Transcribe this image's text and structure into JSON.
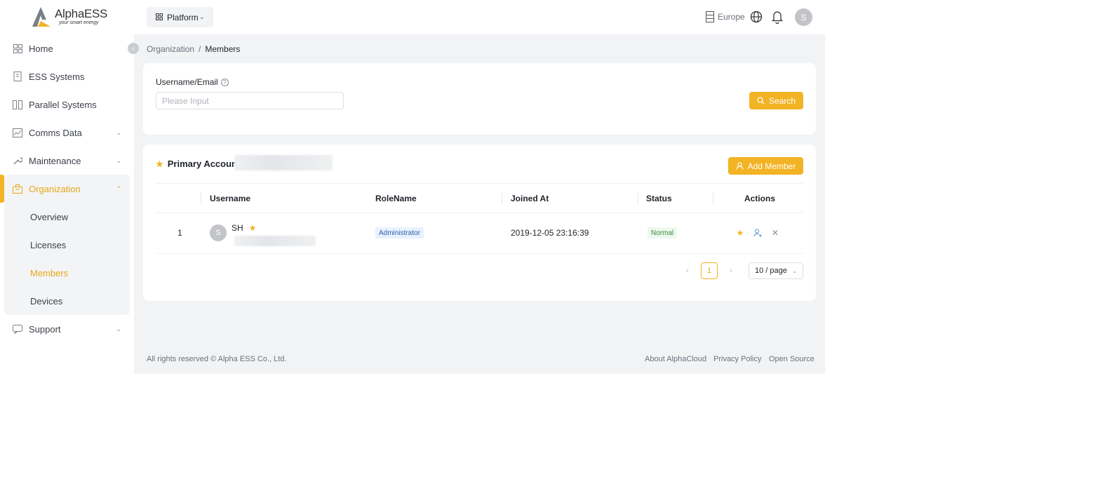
{
  "brand": {
    "name": "AlphaESS",
    "tagline": "your smart energy"
  },
  "sidebar": {
    "items": [
      {
        "label": "Home",
        "icon": "home-icon"
      },
      {
        "label": "ESS Systems",
        "icon": "ess-icon"
      },
      {
        "label": "Parallel Systems",
        "icon": "parallel-icon"
      },
      {
        "label": "Comms Data",
        "icon": "chart-icon"
      },
      {
        "label": "Maintenance",
        "icon": "wrench-icon"
      },
      {
        "label": "Organization",
        "icon": "building-icon"
      },
      {
        "label": "Support",
        "icon": "chat-icon"
      }
    ],
    "org_sub": [
      {
        "label": "Overview"
      },
      {
        "label": "Licenses"
      },
      {
        "label": "Members"
      },
      {
        "label": "Devices"
      }
    ],
    "accent": "#f2b324"
  },
  "topbar": {
    "platform_label": "Platform",
    "region": "Europe",
    "avatar_initial": "S"
  },
  "breadcrumb": {
    "parent": "Organization",
    "separator": "/",
    "current": "Members"
  },
  "search": {
    "label": "Username/Email",
    "placeholder": "Please Input",
    "button": "Search"
  },
  "members": {
    "primary_label": "Primary Account",
    "add_button": "Add Member",
    "columns": [
      "Username",
      "RoleName",
      "Joined At",
      "Status",
      "Actions"
    ],
    "rows": [
      {
        "index": "1",
        "avatar": "S",
        "username": "SH",
        "role": "Administrator",
        "joined_at": "2019-12-05 23:16:39",
        "status": "Normal"
      }
    ],
    "pagination": {
      "current_page": "1",
      "page_size": "10 / page"
    }
  },
  "footer": {
    "copyright": "All rights reserved © Alpha ESS Co., Ltd.",
    "links": [
      "About AlphaCloud",
      "Privacy Policy",
      "Open Source"
    ]
  }
}
